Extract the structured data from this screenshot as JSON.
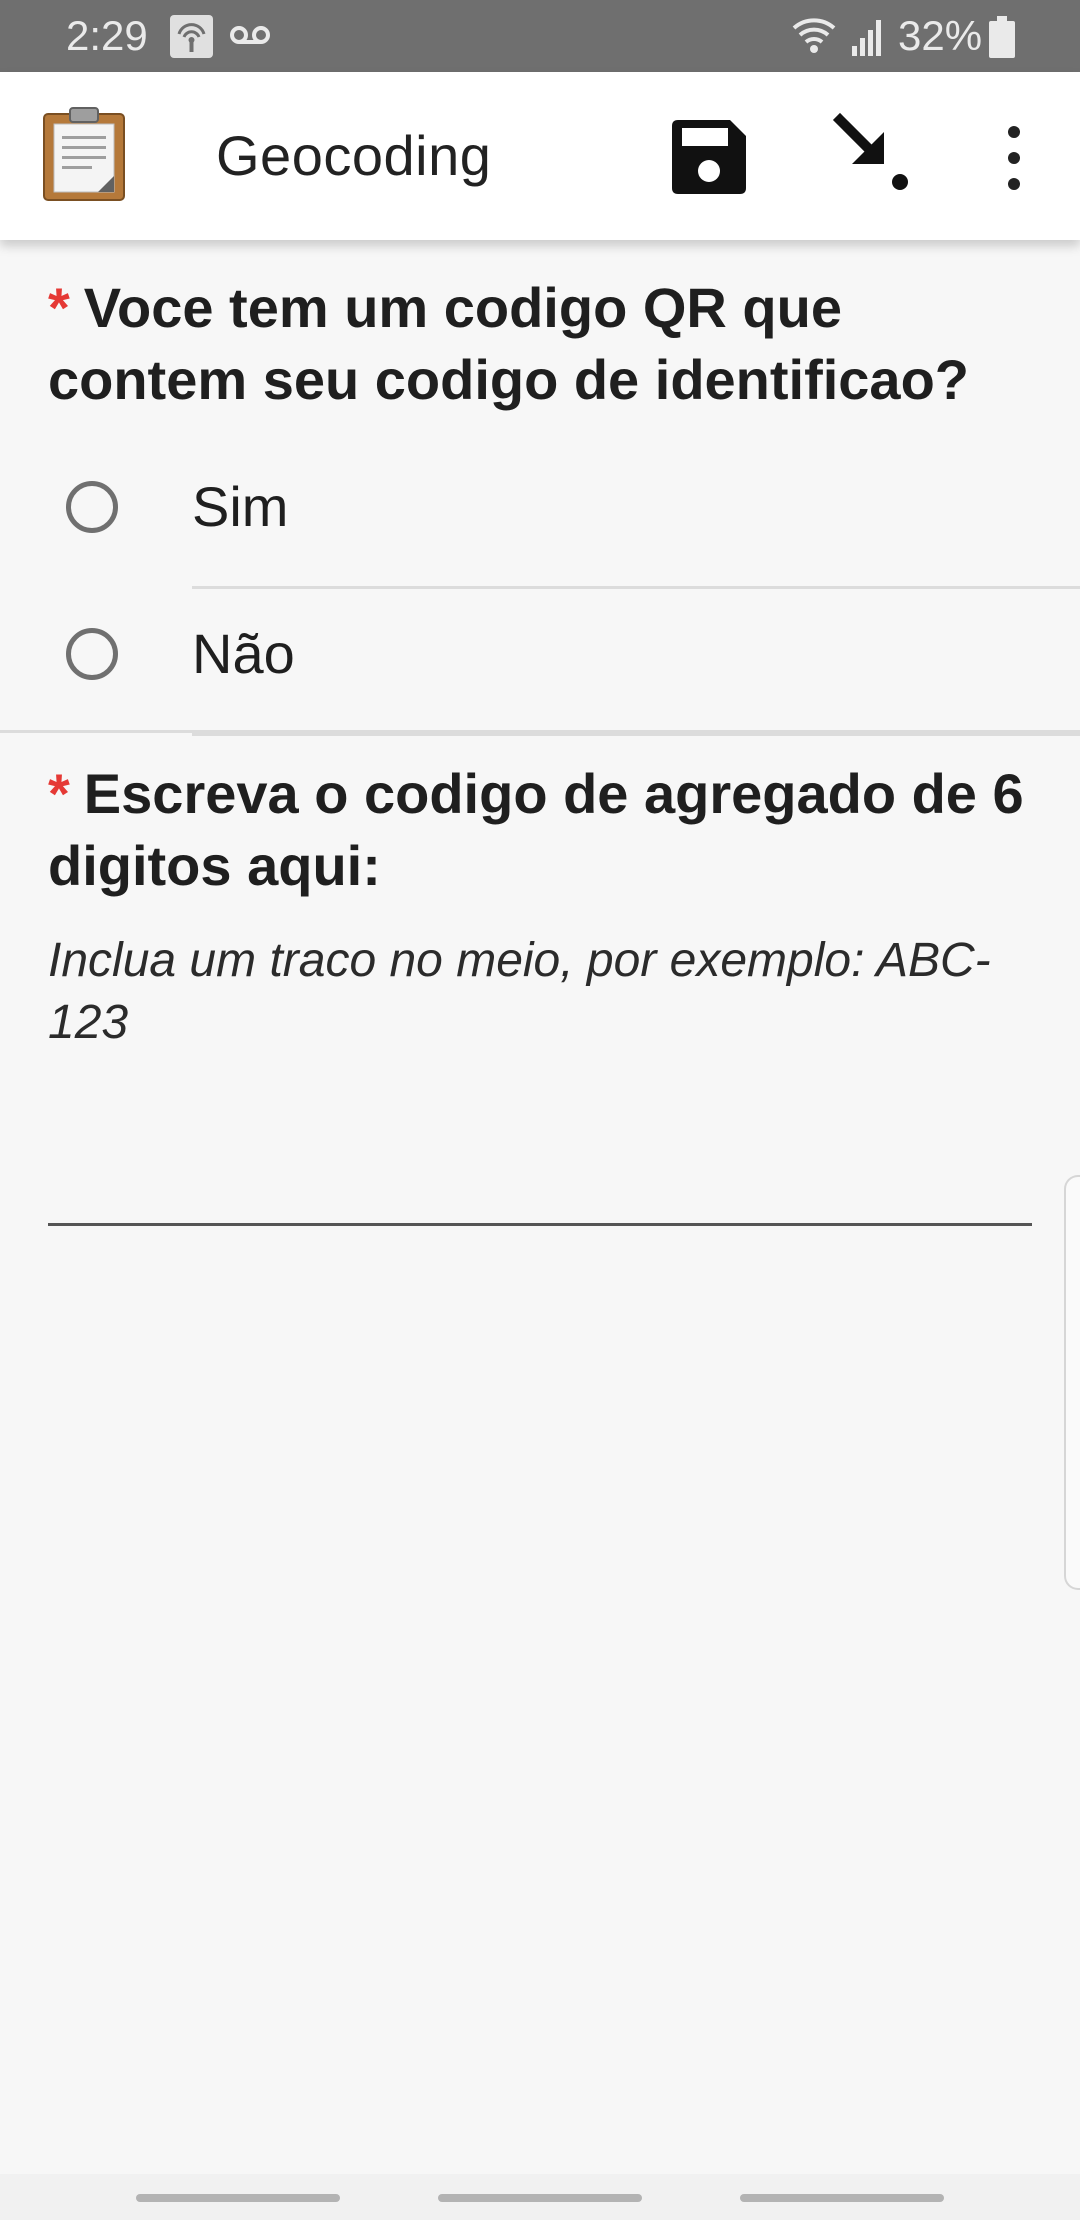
{
  "status_bar": {
    "time": "2:29",
    "battery": "32%",
    "icons": [
      "hotspot-icon",
      "voicemail-icon",
      "wifi-icon",
      "signal-icon",
      "battery-icon"
    ]
  },
  "app_bar": {
    "title": "Geocoding",
    "actions": [
      "save-icon",
      "jump-to-icon",
      "more-vert-icon"
    ],
    "colors": {
      "logo_board": "#b5793a",
      "logo_paper": "#f4f4f4"
    }
  },
  "form": {
    "q1": {
      "required_mark": "*",
      "text": "Voce tem um codigo QR que contem seu codigo de identificao?",
      "options": [
        {
          "label": "Sim"
        },
        {
          "label": "Não"
        }
      ]
    },
    "q2": {
      "required_mark": "*",
      "text": "Escreva o codigo de agregado de 6 digitos aqui:",
      "hint": "Inclua um traco no meio, por exemplo: ABC-123",
      "value": ""
    }
  },
  "colors": {
    "required": "#e53935",
    "status_bar": "#6f6f6f",
    "background": "#f7f7f7"
  }
}
